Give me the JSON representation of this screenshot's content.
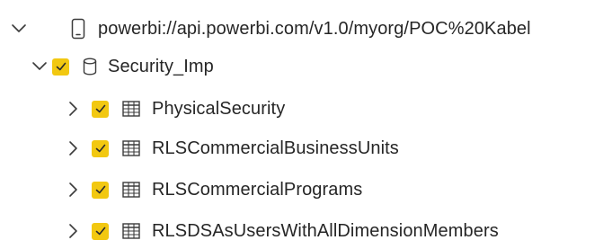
{
  "root": {
    "icon": "phone-device-icon",
    "label": "powerbi://api.powerbi.com/v1.0/myorg/POC%20Kabel",
    "expanded": true
  },
  "database": {
    "icon": "database-cylinder-icon",
    "label": "Security_Imp",
    "checked": true,
    "expanded": true
  },
  "tables": [
    {
      "label": "PhysicalSecurity",
      "checked": true,
      "expanded": false,
      "icon": "table-grid-icon"
    },
    {
      "label": "RLSCommercialBusinessUnits",
      "checked": true,
      "expanded": false,
      "icon": "table-grid-icon"
    },
    {
      "label": "RLSCommercialPrograms",
      "checked": true,
      "expanded": false,
      "icon": "table-grid-icon"
    },
    {
      "label": "RLSDSAsUsersWithAllDimensionMembers",
      "checked": true,
      "expanded": false,
      "icon": "table-grid-icon"
    }
  ],
  "colors": {
    "checkbox_fill": "#f2c811",
    "text": "#262626",
    "icon_stroke": "#3b3b3b"
  }
}
